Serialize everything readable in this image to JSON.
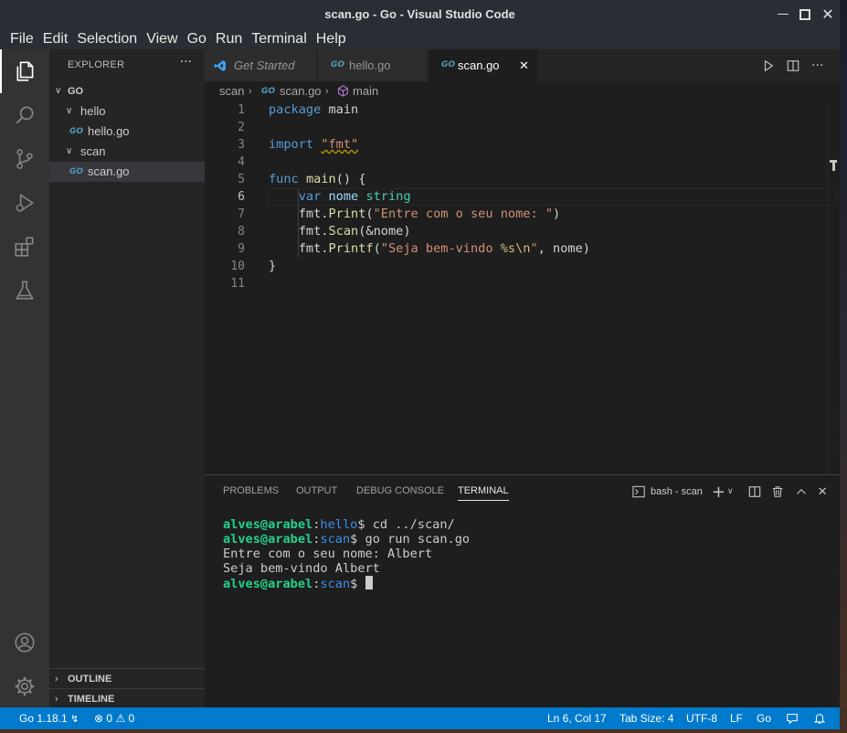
{
  "window": {
    "title": "scan.go - Go - Visual Studio Code"
  },
  "menu": [
    "File",
    "Edit",
    "Selection",
    "View",
    "Go",
    "Run",
    "Terminal",
    "Help"
  ],
  "sidebar": {
    "header": "EXPLORER",
    "root": "GO",
    "tree": [
      {
        "label": "hello",
        "type": "folder"
      },
      {
        "label": "hello.go",
        "type": "file"
      },
      {
        "label": "scan",
        "type": "folder"
      },
      {
        "label": "scan.go",
        "type": "file"
      }
    ],
    "outline": "OUTLINE",
    "timeline": "TIMELINE"
  },
  "tabs": [
    {
      "label": "Get Started"
    },
    {
      "label": "hello.go"
    },
    {
      "label": "scan.go"
    }
  ],
  "breadcrumb": {
    "folder": "scan",
    "file": "scan.go",
    "symbol": "main"
  },
  "editor": {
    "line_numbers": [
      "1",
      "2",
      "3",
      "4",
      "5",
      "6",
      "7",
      "8",
      "9",
      "10",
      "11"
    ],
    "current_line": 6,
    "code": {
      "l1a": "package",
      "l1b": " main",
      "l3a": "import",
      "l3b": " ",
      "l3c": "\"fmt\"",
      "l5a": "func",
      "l5b": " ",
      "l5c": "main",
      "l5d": "() {",
      "l6a": "    ",
      "l6b": "var",
      "l6c": " ",
      "l6d": "nome",
      "l6e": " ",
      "l6f": "string",
      "l7a": "    fmt.",
      "l7b": "Print",
      "l7c": "(",
      "l7d": "\"Entre com o seu nome: \"",
      "l7e": ")",
      "l8a": "    fmt.",
      "l8b": "Scan",
      "l8c": "(&nome)",
      "l9a": "    fmt.",
      "l9b": "Printf",
      "l9c": "(",
      "l9d": "\"Seja bem-vindo ",
      "l9e": "%s\\n",
      "l9f": "\"",
      "l9g": ", nome)",
      "l10": "}"
    }
  },
  "panel": {
    "tabs": [
      "PROBLEMS",
      "OUTPUT",
      "DEBUG CONSOLE",
      "TERMINAL"
    ],
    "terminal_name": "bash - scan",
    "lines": [
      {
        "user": "alves@arabel",
        "dir": "hello",
        "cmd": "$ cd ../scan/"
      },
      {
        "user": "alves@arabel",
        "dir": "scan",
        "cmd": "$ go run scan.go"
      },
      {
        "text": "Entre com o seu nome: Albert"
      },
      {
        "text": "Seja bem-vindo Albert"
      },
      {
        "user": "alves@arabel",
        "dir": "scan",
        "cmd": "$ "
      }
    ],
    "sep": ":"
  },
  "status": {
    "go_version": "Go 1.18.1",
    "errors": "0",
    "warnings": "0",
    "position": "Ln 6, Col 17",
    "tab_size": "Tab Size: 4",
    "encoding": "UTF-8",
    "eol": "LF",
    "language": "Go"
  },
  "colors": {
    "accent": "#007acc",
    "terminal_user": "#23d18b",
    "terminal_dir": "#3b8eea"
  }
}
